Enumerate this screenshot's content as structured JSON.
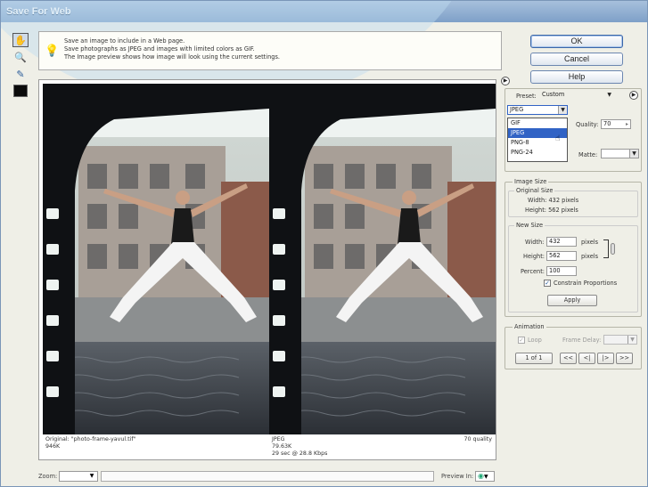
{
  "window": {
    "title": "Save For Web"
  },
  "info": {
    "line1": "Save an image to include in a Web page.",
    "line2": "Save photographs as JPEG and images with limited colors as GIF.",
    "line3": "The Image preview shows how image will look using the current settings."
  },
  "preview": {
    "original_caption": "Original: \"photo-frame-yavul.tif\"",
    "original_size": "946K",
    "optimized_format": "JPEG",
    "optimized_size": "79.63K",
    "optimized_time": "29 sec @ 28.8 Kbps",
    "optimized_quality": "70 quality"
  },
  "bottom": {
    "zoom_label": "Zoom:",
    "zoom_value": "",
    "preview_label": "Preview In:"
  },
  "buttons": {
    "ok": "OK",
    "cancel": "Cancel",
    "help": "Help"
  },
  "settings": {
    "preset_label": "Preset:",
    "preset_value": "Custom",
    "format_value": "JPEG",
    "format_options": [
      "GIF",
      "JPEG",
      "PNG-8",
      "PNG-24"
    ],
    "format_highlighted": "JPEG",
    "quality_label": "Quality:",
    "quality_value": "70",
    "matte_label": "Matte:",
    "matte_value": ""
  },
  "image_size": {
    "group_label": "Image Size",
    "original_label": "Original Size",
    "orig_width": "Width: 432 pixels",
    "orig_height": "Height: 562 pixels",
    "new_label": "New Size",
    "width_label": "Width:",
    "width_value": "432",
    "height_label": "Height:",
    "height_value": "562",
    "unit": "pixels",
    "percent_label": "Percent:",
    "percent_value": "100",
    "constrain_label": "Constrain Proportions",
    "constrain_checked": true,
    "apply_label": "Apply"
  },
  "animation": {
    "group_label": "Animation",
    "loop_label": "Loop",
    "frame_delay_label": "Frame Delay:",
    "frame_counter": "1 of 1",
    "nav": [
      "<<",
      "<|",
      "|>",
      ">>"
    ]
  },
  "colors": {
    "accent": "#3163c5",
    "titlebar": "#7ea0c8"
  }
}
